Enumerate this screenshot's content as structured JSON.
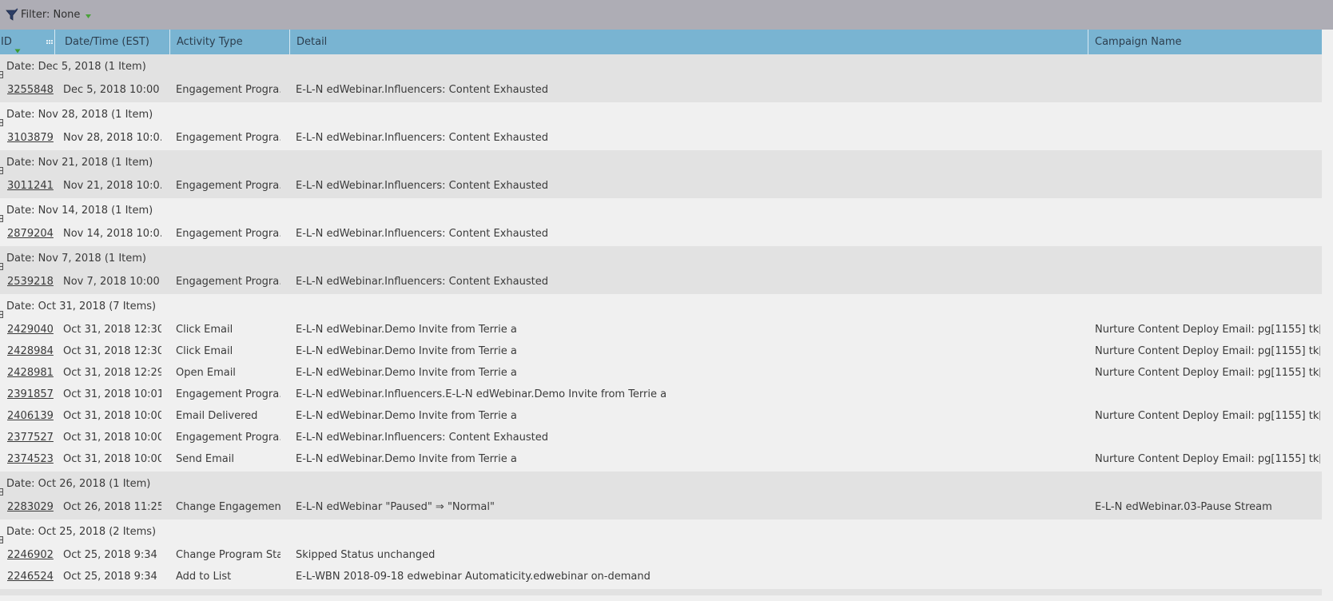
{
  "filter": {
    "label": "Filter: None"
  },
  "columns": {
    "id": "ID",
    "datetime": "Date/Time (EST)",
    "activity_type": "Activity Type",
    "detail": "Detail",
    "campaign": "Campaign Name"
  },
  "groups": [
    {
      "label": "Date: Dec 5, 2018 (1 Item)",
      "rows": [
        {
          "id": "3255848",
          "datetime": "Dec 5, 2018 10:00 ...",
          "type": "Engagement Progra...",
          "detail": "E-L-N edWebinar.Influencers: Content Exhausted",
          "campaign": ""
        }
      ]
    },
    {
      "label": "Date: Nov 28, 2018 (1 Item)",
      "rows": [
        {
          "id": "3103879",
          "datetime": "Nov 28, 2018 10:0...",
          "type": "Engagement Progra...",
          "detail": "E-L-N edWebinar.Influencers: Content Exhausted",
          "campaign": ""
        }
      ]
    },
    {
      "label": "Date: Nov 21, 2018 (1 Item)",
      "rows": [
        {
          "id": "3011241",
          "datetime": "Nov 21, 2018 10:0...",
          "type": "Engagement Progra...",
          "detail": "E-L-N edWebinar.Influencers: Content Exhausted",
          "campaign": ""
        }
      ]
    },
    {
      "label": "Date: Nov 14, 2018 (1 Item)",
      "rows": [
        {
          "id": "2879204",
          "datetime": "Nov 14, 2018 10:0...",
          "type": "Engagement Progra...",
          "detail": "E-L-N edWebinar.Influencers: Content Exhausted",
          "campaign": ""
        }
      ]
    },
    {
      "label": "Date: Nov 7, 2018 (1 Item)",
      "rows": [
        {
          "id": "2539218",
          "datetime": "Nov 7, 2018 10:00 ...",
          "type": "Engagement Progra...",
          "detail": "E-L-N edWebinar.Influencers: Content Exhausted",
          "campaign": ""
        }
      ]
    },
    {
      "label": "Date: Oct 31, 2018 (7 Items)",
      "rows": [
        {
          "id": "2429040",
          "datetime": "Oct 31, 2018 12:30...",
          "type": "Click Email",
          "detail": "E-L-N edWebinar.Demo Invite from Terrie a",
          "campaign": "Nurture Content Deploy Email: pg[1155] tk[..."
        },
        {
          "id": "2428984",
          "datetime": "Oct 31, 2018 12:30...",
          "type": "Click Email",
          "detail": "E-L-N edWebinar.Demo Invite from Terrie a",
          "campaign": "Nurture Content Deploy Email: pg[1155] tk[..."
        },
        {
          "id": "2428981",
          "datetime": "Oct 31, 2018 12:29...",
          "type": "Open Email",
          "detail": "E-L-N edWebinar.Demo Invite from Terrie a",
          "campaign": "Nurture Content Deploy Email: pg[1155] tk[..."
        },
        {
          "id": "2391857",
          "datetime": "Oct 31, 2018 10:01...",
          "type": "Engagement Progra...",
          "detail": "E-L-N edWebinar.Influencers.E-L-N edWebinar.Demo Invite from Terrie a",
          "campaign": ""
        },
        {
          "id": "2406139",
          "datetime": "Oct 31, 2018 10:00...",
          "type": "Email Delivered",
          "detail": "E-L-N edWebinar.Demo Invite from Terrie a",
          "campaign": "Nurture Content Deploy Email: pg[1155] tk[..."
        },
        {
          "id": "2377527",
          "datetime": "Oct 31, 2018 10:00...",
          "type": "Engagement Progra...",
          "detail": "E-L-N edWebinar.Influencers: Content Exhausted",
          "campaign": ""
        },
        {
          "id": "2374523",
          "datetime": "Oct 31, 2018 10:00...",
          "type": "Send Email",
          "detail": "E-L-N edWebinar.Demo Invite from Terrie a",
          "campaign": "Nurture Content Deploy Email: pg[1155] tk[..."
        }
      ]
    },
    {
      "label": "Date: Oct 26, 2018 (1 Item)",
      "rows": [
        {
          "id": "2283029",
          "datetime": "Oct 26, 2018 11:25...",
          "type": "Change Engagemen...",
          "detail": "E-L-N edWebinar \"Paused\" ⇒ \"Normal\"",
          "campaign": "E-L-N edWebinar.03-Pause Stream"
        }
      ]
    },
    {
      "label": "Date: Oct 25, 2018 (2 Items)",
      "rows": [
        {
          "id": "2246902",
          "datetime": "Oct 25, 2018 9:34 ...",
          "type": "Change Program Sta...",
          "detail": "Skipped Status unchanged",
          "campaign": ""
        },
        {
          "id": "2246524",
          "datetime": "Oct 25, 2018 9:34 ...",
          "type": "Add to List",
          "detail": "E-L-WBN 2018-09-18 edwebinar Automaticity.edwebinar on-demand",
          "campaign": ""
        }
      ]
    }
  ]
}
